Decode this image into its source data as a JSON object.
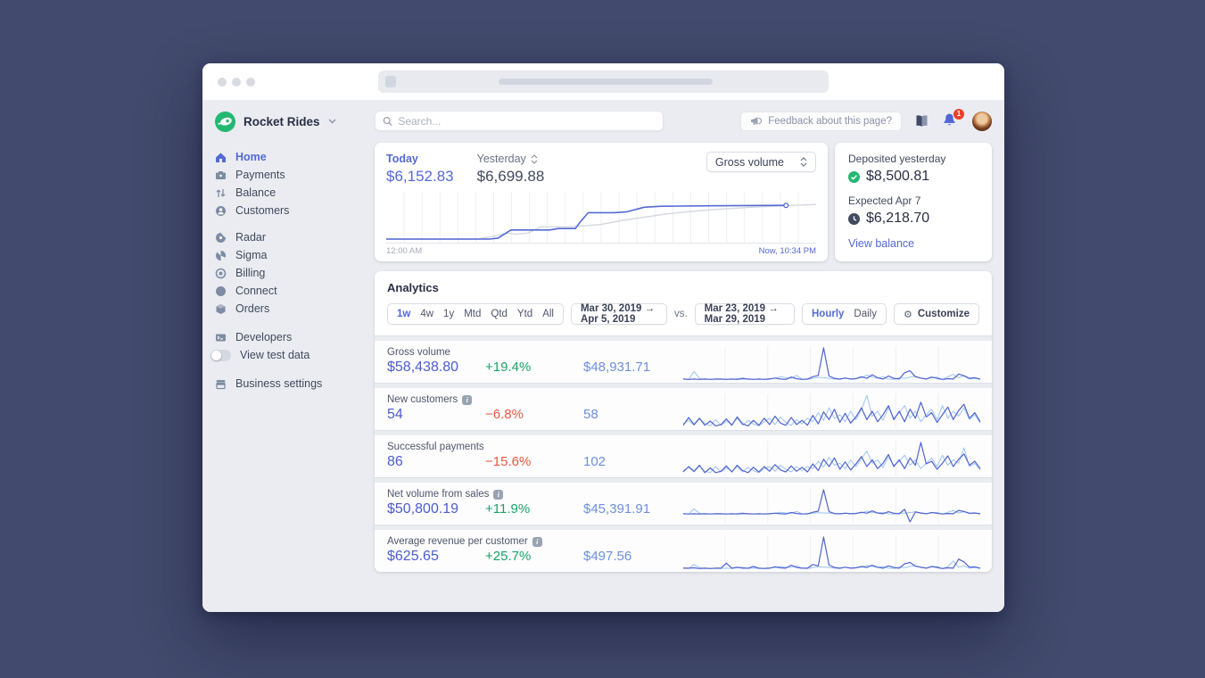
{
  "brand": {
    "name": "Rocket Rides"
  },
  "sidebar": {
    "group1": [
      {
        "label": "Home",
        "active": true
      },
      {
        "label": "Payments"
      },
      {
        "label": "Balance"
      },
      {
        "label": "Customers"
      }
    ],
    "group2": [
      {
        "label": "Radar"
      },
      {
        "label": "Sigma"
      },
      {
        "label": "Billing"
      },
      {
        "label": "Connect"
      },
      {
        "label": "Orders"
      }
    ],
    "developers_label": "Developers",
    "test_toggle_label": "View test data",
    "settings_label": "Business settings"
  },
  "topbar": {
    "search_placeholder": "Search...",
    "feedback_label": "Feedback about this page?",
    "notification_count": "1"
  },
  "today_card": {
    "today_label": "Today",
    "today_value": "$6,152.83",
    "yesterday_label": "Yesterday",
    "yesterday_value": "$6,699.88",
    "select_value": "Gross volume",
    "axis_start": "12:00 AM",
    "axis_end": "Now, 10:34 PM"
  },
  "deposits_card": {
    "deposited_label": "Deposited yesterday",
    "deposited_value": "$8,500.81",
    "expected_label": "Expected Apr 7",
    "expected_value": "$6,218.70",
    "link_label": "View balance"
  },
  "analytics": {
    "title": "Analytics",
    "periods": [
      "1w",
      "4w",
      "1y",
      "Mtd",
      "Qtd",
      "Ytd",
      "All"
    ],
    "active_period": "1w",
    "range_current": "Mar 30, 2019 →  Apr 5, 2019",
    "vs_label": "vs.",
    "range_previous": "Mar 23, 2019 → Mar 29, 2019",
    "interval_hourly": "Hourly",
    "interval_daily": "Daily",
    "active_interval": "Hourly",
    "customize_label": "Customize",
    "rows": [
      {
        "label": "Gross volume",
        "info": false,
        "primary": "$58,438.80",
        "delta": "+19.4%",
        "delta_dir": "up",
        "comparison": "$48,931.71"
      },
      {
        "label": "New customers",
        "info": true,
        "primary": "54",
        "delta": "−6.8%",
        "delta_dir": "down",
        "comparison": "58"
      },
      {
        "label": "Successful payments",
        "info": false,
        "primary": "86",
        "delta": "−15.6%",
        "delta_dir": "down",
        "comparison": "102"
      },
      {
        "label": "Net volume from sales",
        "info": true,
        "primary": "$50,800.19",
        "delta": "+11.9%",
        "delta_dir": "up",
        "comparison": "$45,391.91"
      },
      {
        "label": "Average revenue per customer",
        "info": true,
        "primary": "$625.65",
        "delta": "+25.7%",
        "delta_dir": "up",
        "comparison": "$497.56"
      }
    ]
  },
  "colors": {
    "accent_indigo": "#5469d4",
    "comparison_blue": "#6d8fdd",
    "positive_green": "#1ba368",
    "negative_red": "#e8573f",
    "spark_previous_blue": "#9cc5f0",
    "yesterday_gray": "#d4d8df",
    "brand_green": "#23b871",
    "badge_red": "#e8402d"
  },
  "chart_data": [
    {
      "type": "line",
      "title": "Gross volume today vs yesterday (hourly, cumulative $)",
      "x_start": "12:00 AM",
      "x_end": "Now, 10:34 PM",
      "grid_columns": 24,
      "axis_line": true,
      "series": [
        {
          "name": "yesterday",
          "color": "#d4d8df",
          "width": 1.4,
          "points": [
            [
              0,
              4
            ],
            [
              21,
              4
            ],
            [
              25,
              10
            ],
            [
              28,
              17
            ],
            [
              30,
              15
            ],
            [
              33,
              17
            ],
            [
              36,
              31
            ],
            [
              43,
              31
            ],
            [
              46,
              33
            ],
            [
              50,
              36
            ],
            [
              55,
              45
            ],
            [
              60,
              52
            ],
            [
              65,
              59
            ],
            [
              70,
              64
            ],
            [
              75,
              68
            ],
            [
              80,
              71
            ],
            [
              85,
              74
            ],
            [
              90,
              76
            ],
            [
              95,
              78
            ],
            [
              100,
              80
            ]
          ]
        },
        {
          "name": "today",
          "color": "#5469d4",
          "width": 1.6,
          "marker": true,
          "points": [
            [
              0,
              4
            ],
            [
              24,
              4
            ],
            [
              26,
              6
            ],
            [
              29,
              24
            ],
            [
              38,
              24
            ],
            [
              40,
              27
            ],
            [
              44,
              27
            ],
            [
              45,
              40
            ],
            [
              47,
              62
            ],
            [
              53,
              62
            ],
            [
              56,
              64
            ],
            [
              60,
              74
            ],
            [
              64,
              76
            ],
            [
              75,
              77
            ],
            [
              93,
              78
            ]
          ]
        }
      ]
    },
    {
      "type": "line",
      "title": "Gross volume sparkline",
      "grid_columns": 7,
      "series": [
        {
          "name": "previous",
          "color": "#9cc5f0",
          "width": 1,
          "values": [
            4,
            2,
            26,
            5,
            2,
            3,
            2,
            2,
            3,
            2,
            4,
            7,
            2,
            3,
            2,
            3,
            4,
            5,
            10,
            7,
            5,
            14,
            3,
            2,
            5,
            8,
            7,
            5,
            3,
            2,
            7,
            3,
            5,
            7,
            15,
            9,
            5,
            10,
            3,
            2,
            7,
            5,
            9,
            12,
            5,
            3,
            7,
            9,
            2,
            10,
            17,
            7,
            12,
            3,
            5,
            2
          ]
        },
        {
          "name": "current",
          "color": "#4f63ce",
          "width": 1.2,
          "values": [
            3,
            2,
            3,
            2,
            3,
            2,
            3,
            3,
            2,
            3,
            2,
            4,
            3,
            2,
            3,
            2,
            3,
            6,
            3,
            2,
            9,
            4,
            2,
            3,
            10,
            14,
            97,
            12,
            5,
            3,
            6,
            3,
            4,
            10,
            5,
            16,
            7,
            3,
            12,
            5,
            3,
            22,
            28,
            10,
            6,
            3,
            9,
            5,
            2,
            4,
            3,
            18,
            13,
            5,
            7,
            3
          ]
        }
      ]
    },
    {
      "type": "line",
      "title": "New customers sparkline",
      "grid_columns": 7,
      "series": [
        {
          "name": "previous",
          "color": "#9cc5f0",
          "width": 1,
          "values": [
            10,
            20,
            6,
            24,
            12,
            4,
            22,
            6,
            18,
            8,
            26,
            6,
            20,
            10,
            4,
            16,
            26,
            8,
            30,
            14,
            6,
            22,
            10,
            26,
            16,
            42,
            20,
            56,
            26,
            36,
            16,
            46,
            22,
            50,
            92,
            32,
            46,
            20,
            56,
            26,
            42,
            62,
            26,
            46,
            16,
            36,
            52,
            22,
            62,
            26,
            46,
            32,
            56,
            22,
            36,
            12
          ]
        },
        {
          "name": "current",
          "color": "#4f63ce",
          "width": 1.2,
          "values": [
            6,
            28,
            8,
            26,
            6,
            18,
            4,
            8,
            24,
            6,
            30,
            10,
            4,
            20,
            6,
            26,
            8,
            32,
            12,
            6,
            28,
            8,
            20,
            6,
            34,
            10,
            44,
            22,
            52,
            14,
            40,
            12,
            30,
            56,
            22,
            46,
            16,
            36,
            62,
            22,
            46,
            16,
            52,
            26,
            72,
            30,
            42,
            14,
            36,
            58,
            22,
            48,
            66,
            26,
            42,
            16
          ]
        }
      ]
    },
    {
      "type": "line",
      "title": "Successful payments sparkline",
      "grid_columns": 7,
      "series": [
        {
          "name": "previous",
          "color": "#9cc5f0",
          "width": 1,
          "values": [
            12,
            22,
            8,
            26,
            10,
            6,
            24,
            8,
            20,
            10,
            24,
            8,
            22,
            12,
            6,
            18,
            24,
            10,
            28,
            16,
            8,
            24,
            12,
            24,
            18,
            40,
            22,
            52,
            28,
            34,
            18,
            44,
            24,
            48,
            70,
            34,
            44,
            22,
            52,
            28,
            40,
            58,
            28,
            44,
            18,
            34,
            50,
            24,
            58,
            28,
            44,
            34,
            80,
            24,
            34,
            14
          ]
        },
        {
          "name": "current",
          "color": "#4f63ce",
          "width": 1.2,
          "values": [
            8,
            24,
            10,
            28,
            6,
            20,
            6,
            10,
            26,
            8,
            28,
            12,
            6,
            22,
            8,
            24,
            10,
            30,
            14,
            8,
            26,
            10,
            22,
            8,
            32,
            12,
            46,
            24,
            50,
            16,
            38,
            14,
            32,
            54,
            24,
            44,
            18,
            34,
            60,
            24,
            44,
            18,
            50,
            28,
            96,
            32,
            40,
            16,
            34,
            56,
            24,
            46,
            62,
            28,
            40,
            18
          ]
        }
      ]
    },
    {
      "type": "line",
      "title": "Net volume from sales sparkline",
      "grid_columns": 7,
      "series": [
        {
          "name": "previous",
          "color": "#9cc5f0",
          "width": 1,
          "values": [
            4,
            2,
            22,
            5,
            2,
            3,
            2,
            2,
            3,
            2,
            4,
            6,
            2,
            3,
            2,
            3,
            4,
            5,
            9,
            6,
            5,
            12,
            3,
            2,
            5,
            7,
            6,
            5,
            3,
            2,
            6,
            3,
            5,
            6,
            13,
            8,
            5,
            9,
            3,
            2,
            6,
            5,
            8,
            11,
            5,
            3,
            7,
            8,
            2,
            9,
            15,
            6,
            11,
            3,
            5,
            2
          ]
        },
        {
          "name": "current",
          "color": "#4f63ce",
          "width": 1.2,
          "values": [
            3,
            2,
            3,
            2,
            3,
            2,
            3,
            3,
            2,
            3,
            2,
            4,
            3,
            2,
            3,
            2,
            3,
            5,
            3,
            2,
            8,
            4,
            2,
            3,
            9,
            13,
            95,
            11,
            4,
            3,
            5,
            3,
            4,
            9,
            5,
            14,
            6,
            3,
            11,
            5,
            3,
            20,
            -28,
            10,
            6,
            3,
            8,
            5,
            2,
            4,
            3,
            16,
            12,
            5,
            6,
            3
          ]
        }
      ]
    },
    {
      "type": "line",
      "title": "Average revenue per customer sparkline",
      "grid_columns": 7,
      "series": [
        {
          "name": "previous",
          "color": "#9cc5f0",
          "width": 1,
          "values": [
            4,
            2,
            14,
            5,
            2,
            3,
            2,
            2,
            3,
            2,
            4,
            6,
            2,
            3,
            2,
            3,
            4,
            5,
            8,
            6,
            5,
            10,
            3,
            2,
            5,
            7,
            6,
            5,
            3,
            2,
            6,
            3,
            5,
            6,
            11,
            8,
            5,
            8,
            3,
            2,
            6,
            5,
            8,
            10,
            5,
            3,
            7,
            8,
            2,
            8,
            24,
            6,
            10,
            3,
            5,
            2
          ]
        },
        {
          "name": "current",
          "color": "#4f63ce",
          "width": 1.2,
          "values": [
            3,
            3,
            4,
            2,
            3,
            2,
            3,
            3,
            18,
            3,
            6,
            3,
            3,
            8,
            3,
            2,
            3,
            7,
            4,
            3,
            12,
            5,
            3,
            3,
            14,
            10,
            96,
            12,
            5,
            3,
            6,
            3,
            4,
            8,
            5,
            12,
            6,
            3,
            10,
            5,
            3,
            16,
            20,
            9,
            6,
            3,
            8,
            5,
            2,
            4,
            3,
            30,
            22,
            6,
            7,
            3
          ]
        }
      ]
    }
  ]
}
